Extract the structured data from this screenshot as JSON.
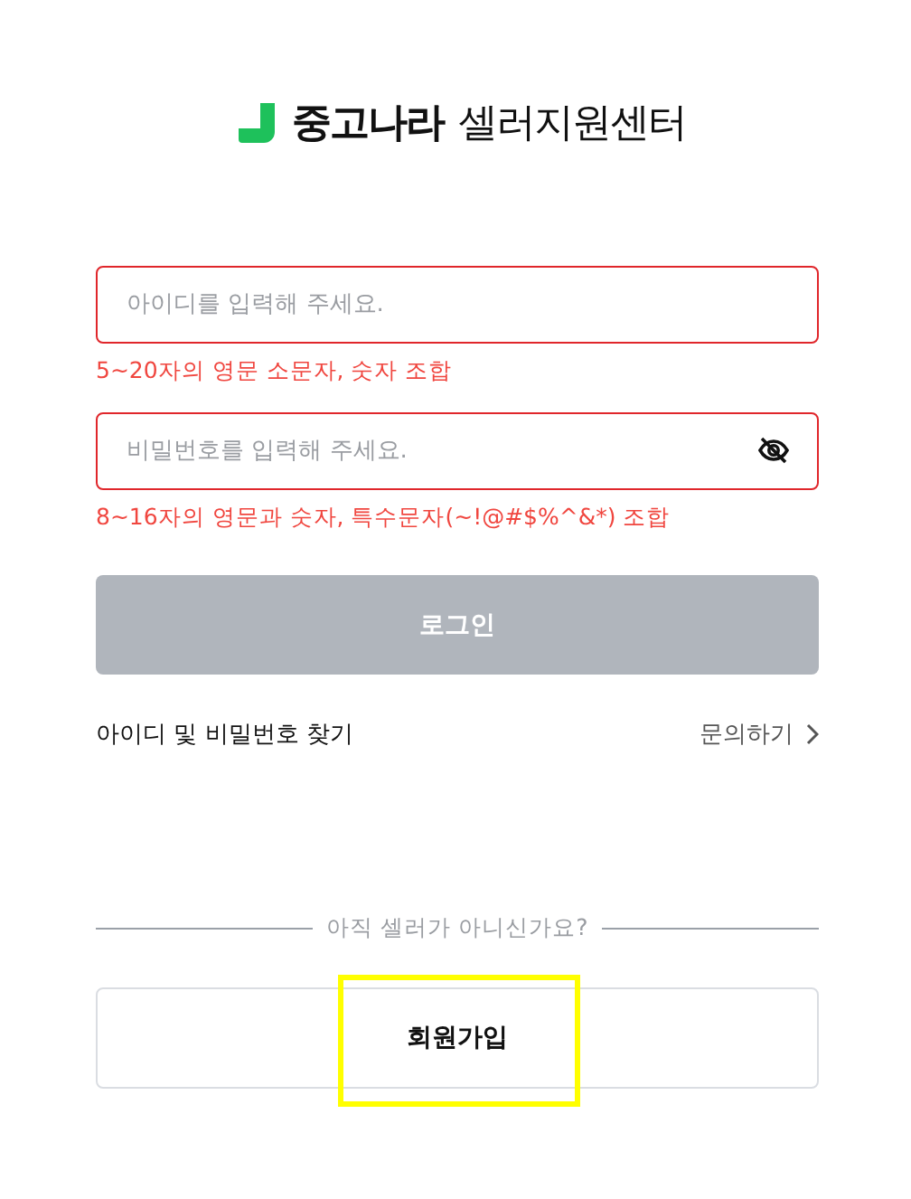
{
  "logo": {
    "brand": "중고나라",
    "subtitle": "셀러지원센터"
  },
  "fields": [
    {
      "kind": "text",
      "placeholder": "아이디를 입력해 주세요.",
      "error": true,
      "hint": "5~20자의 영문 소문자, 숫자 조합"
    },
    {
      "kind": "password",
      "placeholder": "비밀번호를 입력해 주세요.",
      "error": true,
      "hint": "8~16자의 영문과 숫자, 특수문자(~!@#$%^&*) 조합"
    }
  ],
  "login_button": {
    "label": "로그인",
    "disabled": true
  },
  "find_link": "아이디 및 비밀번호 찾기",
  "contact_link": "문의하기",
  "divider_text": "아직 셀러가 아니신가요?",
  "signup_button": {
    "label": "회원가입",
    "highlighted": true
  }
}
